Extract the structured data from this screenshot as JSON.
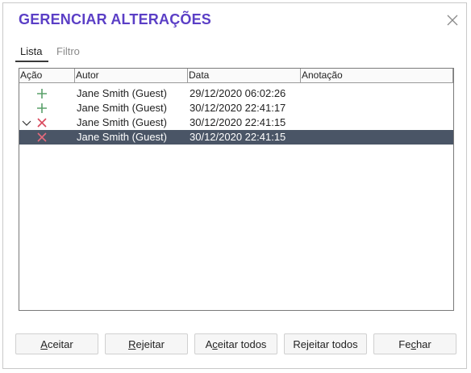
{
  "dialog": {
    "title": "GERENCIAR ALTERAÇÕES"
  },
  "tabs": [
    {
      "label": "Lista",
      "active": true
    },
    {
      "label": "Filtro",
      "active": false
    }
  ],
  "table": {
    "columns": [
      "Ação",
      "Autor",
      "Data",
      "Anotação"
    ],
    "rows": [
      {
        "action_icon": "plus-icon",
        "author": "Jane Smith (Guest)",
        "date": "29/12/2020 06:02:26",
        "note": "",
        "expander": false,
        "selected": false
      },
      {
        "action_icon": "plus-icon",
        "author": "Jane Smith (Guest)",
        "date": "30/12/2020 22:41:17",
        "note": "",
        "expander": false,
        "selected": false
      },
      {
        "action_icon": "cross-icon",
        "author": "Jane Smith (Guest)",
        "date": "30/12/2020 22:41:15",
        "note": "",
        "expander": true,
        "selected": false
      },
      {
        "action_icon": "cross-icon",
        "author": "Jane Smith (Guest)",
        "date": "30/12/2020 22:41:15",
        "note": "",
        "expander": false,
        "selected": true
      }
    ]
  },
  "buttons": [
    {
      "label": "Aceitar",
      "mnemonic": "A"
    },
    {
      "label": "Rejeitar",
      "mnemonic": "R"
    },
    {
      "label": "Aceitar todos",
      "mnemonic": "c"
    },
    {
      "label": "Rejeitar todos",
      "mnemonic": "j"
    },
    {
      "label": "Fechar",
      "mnemonic": "c"
    }
  ],
  "colors": {
    "title": "#5b3fc6",
    "plus_icon": "#5aa06a",
    "cross_icon": "#d9475c",
    "selected_row": "#4a5566"
  }
}
